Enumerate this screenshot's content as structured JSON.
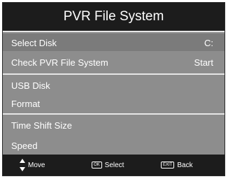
{
  "title": "PVR File System",
  "rows": [
    {
      "label": "Select Disk",
      "value": "C:"
    },
    {
      "label": "Check PVR File System",
      "value": "Start"
    },
    {
      "label": "USB Disk",
      "value": ""
    },
    {
      "label": "Format",
      "value": ""
    },
    {
      "label": "Time Shift Size",
      "value": ""
    },
    {
      "label": "Speed",
      "value": ""
    }
  ],
  "footer": {
    "move_label": "Move",
    "select_label": "Select",
    "select_key": "OK",
    "back_label": "Back",
    "back_key": "EXIT"
  },
  "icons": {
    "move": "up-down-arrows-icon",
    "select": "ok-key-icon",
    "back": "exit-key-icon"
  },
  "colors": {
    "title_bar": "#1c1c1c",
    "menu_background": "#8d8d8d",
    "divider": "#e6e6e6",
    "text": "#ffffff"
  }
}
